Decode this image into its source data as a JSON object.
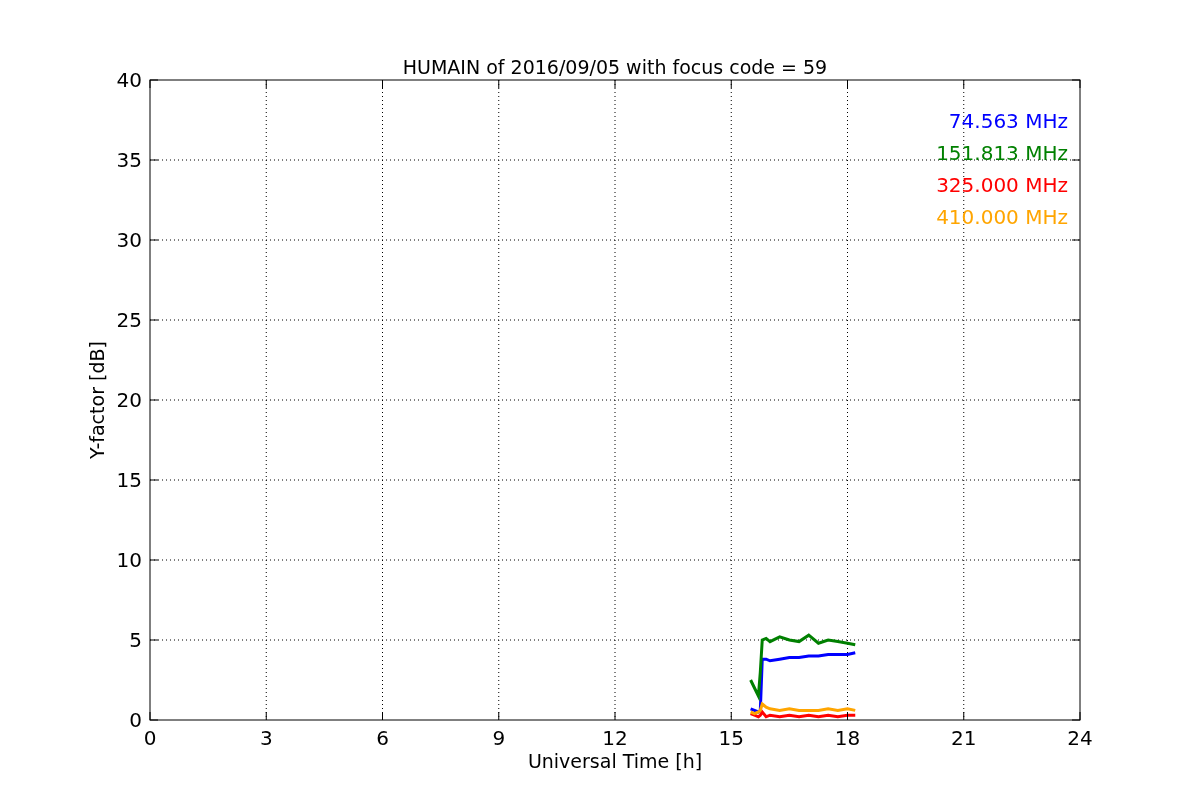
{
  "chart_data": {
    "type": "line",
    "title": "HUMAIN of 2016/09/05 with focus code = 59",
    "xlabel": "Universal Time [h]",
    "ylabel": "Y-factor [dB]",
    "x": [
      15.5,
      15.6,
      15.7,
      15.75,
      15.8,
      15.9,
      16.0,
      16.25,
      16.5,
      16.75,
      17.0,
      17.25,
      17.5,
      17.75,
      18.0,
      18.2
    ],
    "series": [
      {
        "name": "74.563 MHz",
        "color": "#0000ff",
        "values": [
          0.7,
          0.6,
          0.5,
          0.6,
          3.8,
          3.8,
          3.7,
          3.8,
          3.9,
          3.9,
          4.0,
          4.0,
          4.1,
          4.1,
          4.1,
          4.2
        ]
      },
      {
        "name": "151.813 MHz",
        "color": "#008000",
        "values": [
          2.5,
          2.0,
          1.5,
          3.0,
          5.0,
          5.1,
          4.9,
          5.2,
          5.0,
          4.9,
          5.3,
          4.8,
          5.0,
          4.9,
          4.8,
          4.7
        ]
      },
      {
        "name": "325.000 MHz",
        "color": "#ff0000",
        "values": [
          0.4,
          0.3,
          0.2,
          0.3,
          0.5,
          0.2,
          0.3,
          0.2,
          0.3,
          0.2,
          0.3,
          0.2,
          0.3,
          0.2,
          0.3,
          0.3
        ]
      },
      {
        "name": "410.000 MHz",
        "color": "#ffa500",
        "values": [
          0.5,
          0.4,
          0.5,
          0.6,
          1.0,
          0.8,
          0.7,
          0.6,
          0.7,
          0.6,
          0.6,
          0.6,
          0.7,
          0.6,
          0.7,
          0.6
        ]
      }
    ],
    "grid": true,
    "xlim": [
      0,
      24
    ],
    "ylim": [
      0,
      40
    ],
    "xticks": [
      0,
      3,
      6,
      9,
      12,
      15,
      18,
      21,
      24
    ],
    "yticks": [
      0,
      5,
      10,
      15,
      20,
      25,
      30,
      35,
      40
    ]
  }
}
